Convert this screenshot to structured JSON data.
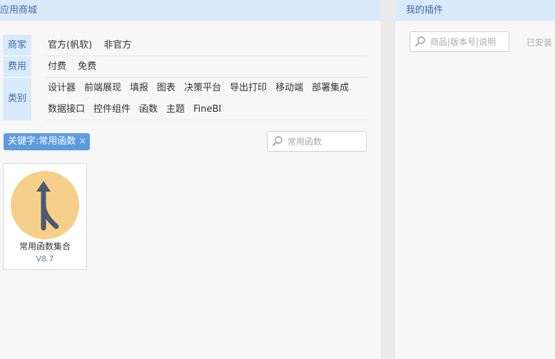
{
  "store": {
    "title": "应用商城",
    "filters": {
      "vendor": {
        "label": "商家",
        "options": [
          "官方(帆软)",
          "非官方"
        ]
      },
      "fee": {
        "label": "费用",
        "options": [
          "付费",
          "免费"
        ]
      },
      "category": {
        "label": "类别",
        "options_line1": [
          "设计器",
          "前端展现",
          "填报",
          "图表",
          "决策平台",
          "导出打印",
          "移动端",
          "部署集成"
        ],
        "options_line2": [
          "数据接口",
          "控件组件",
          "函数",
          "主题",
          "FineBI"
        ]
      }
    },
    "keyword_tag": {
      "text": "关键字:常用函数",
      "remove": "×"
    },
    "search": {
      "placeholder": "常用函数"
    },
    "plugins": [
      {
        "name": "常用函数集合",
        "version": "V8.7",
        "icon": "merge-arrow-icon",
        "icon_bg": "#f6cf8a",
        "icon_fg": "#4a5a72"
      }
    ]
  },
  "my_plugins": {
    "title": "我的插件",
    "search": {
      "placeholder": "商品|版本号|说明"
    },
    "installed_label": "已安装"
  },
  "colors": {
    "header_bg": "#d9eafb",
    "header_text": "#3e6ea6",
    "tag_bg": "#5b9be0"
  }
}
